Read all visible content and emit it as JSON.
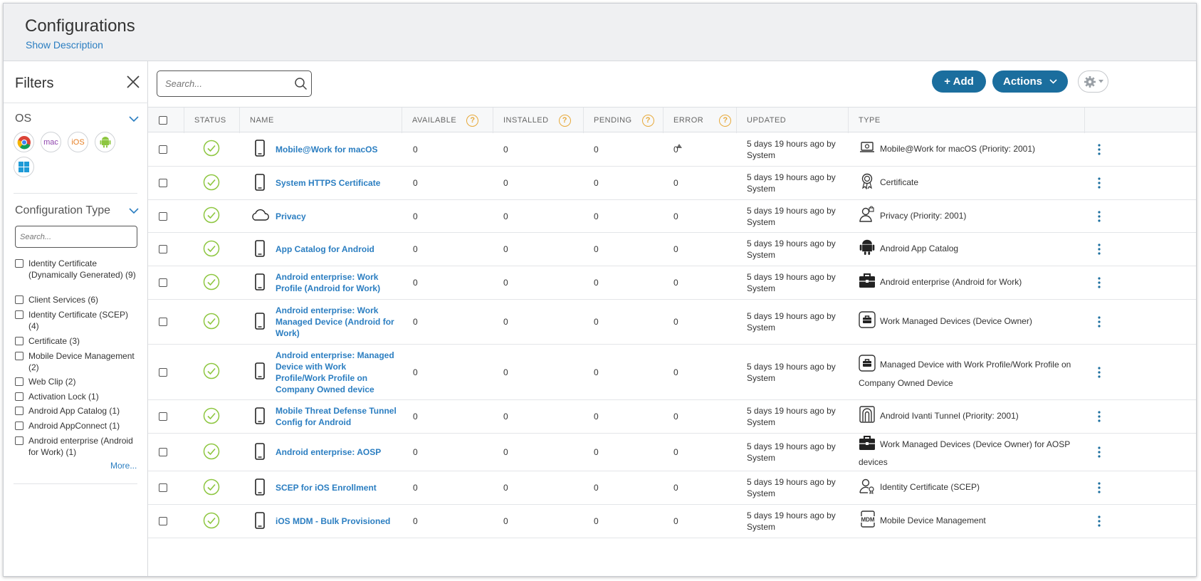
{
  "header": {
    "title": "Configurations",
    "show_description": "Show Description"
  },
  "filters": {
    "title": "Filters",
    "os_label": "OS",
    "os_icons": [
      "chrome-icon",
      "mac",
      "iOS",
      "android-icon",
      "windows-icon"
    ],
    "config_type_label": "Configuration Type",
    "search_placeholder": "Search...",
    "items": [
      "Identity Certificate (Dynamically Generated) (9)",
      "Client Services (6)",
      "Identity Certificate (SCEP) (4)",
      "Certificate (3)",
      "Mobile Device Management (2)",
      "Web Clip (2)",
      "Activation Lock (1)",
      "Android App Catalog (1)",
      "Android AppConnect (1)",
      "Android enterprise (Android for Work) (1)"
    ],
    "more": "More..."
  },
  "toolbar": {
    "search_placeholder": "Search...",
    "add_label": "+ Add",
    "actions_label": "Actions"
  },
  "columns": {
    "status": "STATUS",
    "name": "NAME",
    "available": "AVAILABLE",
    "installed": "INSTALLED",
    "pending": "PENDING",
    "error": "ERROR",
    "updated": "UPDATED",
    "type": "TYPE"
  },
  "rows": [
    {
      "icon": "phone",
      "name": "Mobile@Work for macOS",
      "available": "0",
      "installed": "0",
      "pending": "0",
      "error": "0",
      "updated": "5 days 19 hours ago by System",
      "type_icon": "laptop-icon",
      "type": "Mobile@Work for macOS (Priority: 2001)"
    },
    {
      "icon": "phone",
      "name": "System HTTPS Certificate",
      "available": "0",
      "installed": "0",
      "pending": "0",
      "error": "0",
      "updated": "5 days 19 hours ago by System",
      "type_icon": "certificate-icon",
      "type": "Certificate"
    },
    {
      "icon": "cloud",
      "name": "Privacy",
      "available": "0",
      "installed": "0",
      "pending": "0",
      "error": "0",
      "updated": "5 days 19 hours ago by System",
      "type_icon": "privacy-icon",
      "type": "Privacy (Priority: 2001)"
    },
    {
      "icon": "phone",
      "name": "App Catalog for Android",
      "available": "0",
      "installed": "0",
      "pending": "0",
      "error": "0",
      "updated": "5 days 19 hours ago by System",
      "type_icon": "android-icon",
      "type": "Android App Catalog"
    },
    {
      "icon": "phone",
      "name": "Android enterprise: Work Profile (Android for Work)",
      "available": "0",
      "installed": "0",
      "pending": "0",
      "error": "0",
      "updated": "5 days 19 hours ago by System",
      "type_icon": "briefcase-icon",
      "type": "Android enterprise (Android for Work)"
    },
    {
      "icon": "phone",
      "name": "Android enterprise: Work Managed Device (Android for Work)",
      "available": "0",
      "installed": "0",
      "pending": "0",
      "error": "0",
      "updated": "5 days 19 hours ago by System",
      "type_icon": "managed-device-icon",
      "type": "Work Managed Devices (Device Owner)"
    },
    {
      "icon": "phone",
      "name": "Android enterprise: Managed Device with Work Profile/Work Profile on Company Owned device",
      "available": "0",
      "installed": "0",
      "pending": "0",
      "error": "0",
      "updated": "5 days 19 hours ago by System",
      "type_icon": "managed-device-icon",
      "type": "Managed Device with Work Profile/Work Profile on Company Owned Device"
    },
    {
      "icon": "phone",
      "name": "Mobile Threat Defense Tunnel Config for Android",
      "available": "0",
      "installed": "0",
      "pending": "0",
      "error": "0",
      "updated": "5 days 19 hours ago by System",
      "type_icon": "tunnel-icon",
      "type": "Android Ivanti Tunnel (Priority: 2001)"
    },
    {
      "icon": "phone",
      "name": "Android enterprise: AOSP",
      "available": "0",
      "installed": "0",
      "pending": "0",
      "error": "0",
      "updated": "5 days 19 hours ago by System",
      "type_icon": "briefcase-icon",
      "type": "Work Managed Devices (Device Owner) for AOSP devices"
    },
    {
      "icon": "phone",
      "name": "SCEP for iOS Enrollment",
      "available": "0",
      "installed": "0",
      "pending": "0",
      "error": "0",
      "updated": "5 days 19 hours ago by System",
      "type_icon": "identity-cert-icon",
      "type": "Identity Certificate (SCEP)"
    },
    {
      "icon": "phone",
      "name": "iOS MDM - Bulk Provisioned",
      "available": "0",
      "installed": "0",
      "pending": "0",
      "error": "0",
      "updated": "5 days 19 hours ago by System",
      "type_icon": "mdm-icon",
      "type": "Mobile Device Management"
    }
  ],
  "colors": {
    "link": "#2b7ec1",
    "button": "#1b6e9e",
    "status_ok": "#8dc63f",
    "help": "#e7a93a"
  }
}
